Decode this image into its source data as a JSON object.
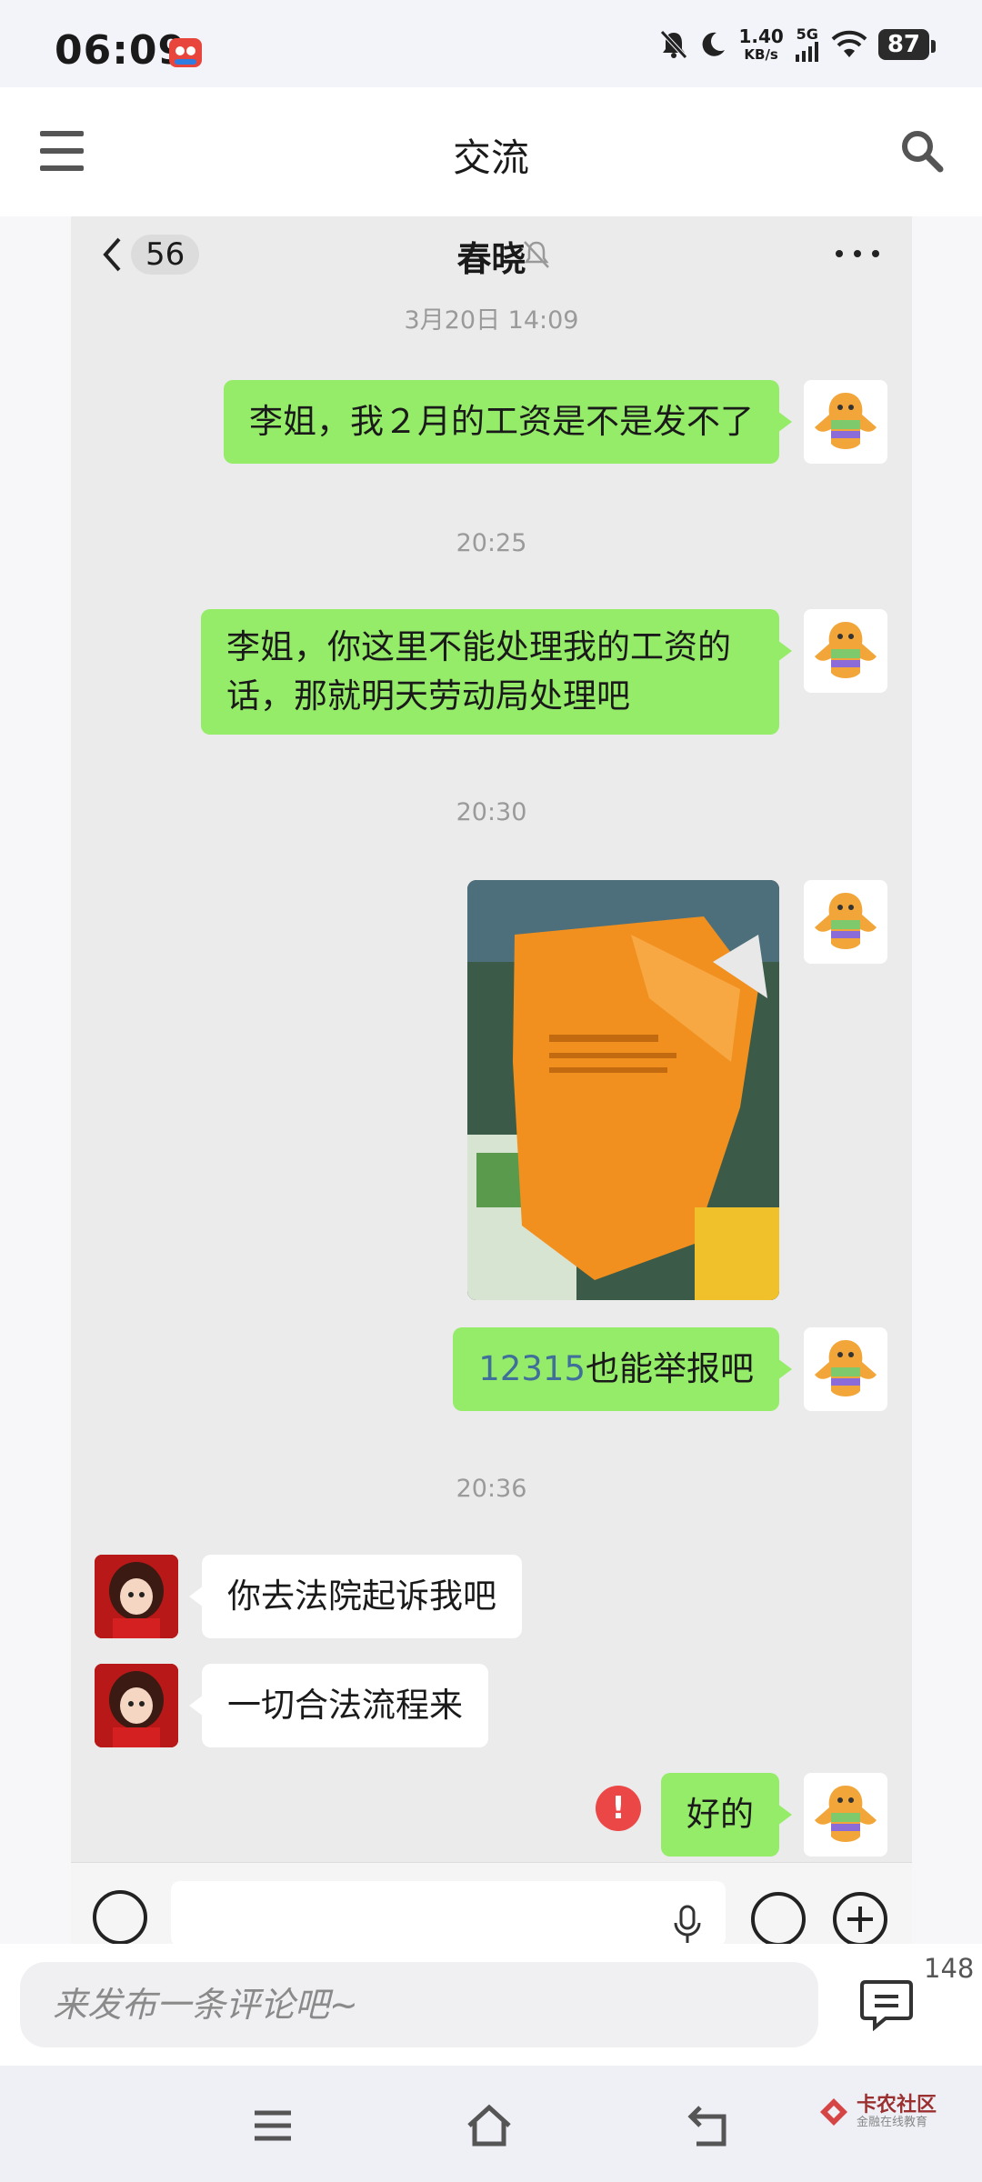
{
  "status_bar": {
    "time": "06:09",
    "net_speed": "1.40",
    "net_unit": "KB/s",
    "network": "5G",
    "battery": "87"
  },
  "header": {
    "title": "交流"
  },
  "chat": {
    "unread_count": "56",
    "contact_name": "春晓",
    "timestamps": [
      "3月20日 14:09",
      "20:25",
      "20:30",
      "20:36"
    ],
    "messages": [
      {
        "from": "me",
        "text": "李姐，我２月的工资是不是发不了"
      },
      {
        "from": "me",
        "lines": [
          "李姐，你这里不能处理我的工资的",
          "话，那就明天劳动局处理吧"
        ]
      },
      {
        "from": "me",
        "type": "image"
      },
      {
        "from": "me",
        "number": "12315",
        "text": " 也能举报吧"
      },
      {
        "from": "them",
        "text": "你去法院起诉我吧"
      },
      {
        "from": "them",
        "text": "一切合法流程来"
      },
      {
        "from": "me",
        "text": "好的",
        "status": "send-failed"
      }
    ],
    "error_mark": "!"
  },
  "comment_bar": {
    "placeholder": "来发布一条评论吧~",
    "count": "148"
  },
  "watermark": {
    "brand": "卡农社区",
    "tagline": "金融在线教育"
  },
  "colors": {
    "my_bubble": "#95ec69",
    "their_bubble": "#ffffff",
    "chat_bg": "#ebebeb",
    "error": "#ec4747"
  }
}
